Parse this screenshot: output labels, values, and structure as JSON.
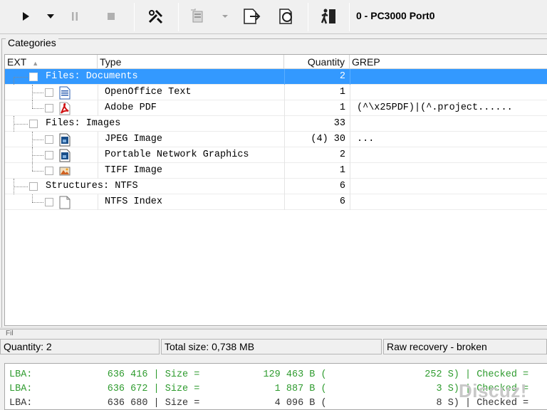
{
  "toolbar": {
    "buttons": [
      {
        "name": "play-button",
        "icon": "play-icon"
      },
      {
        "name": "play-options-dropdown",
        "icon": "chevron-down-icon"
      },
      {
        "name": "pause-button",
        "icon": "pause-icon"
      },
      {
        "name": "stop-button",
        "icon": "stop-icon"
      },
      {
        "name": "tools-button",
        "icon": "tools-icon"
      },
      {
        "name": "add-button",
        "icon": "add-file-icon"
      },
      {
        "name": "export-button",
        "icon": "export-icon"
      },
      {
        "name": "refresh-button",
        "icon": "refresh-icon"
      },
      {
        "name": "exit-button",
        "icon": "exit-icon"
      }
    ],
    "port_title": "0 - PC3000 Port0"
  },
  "categories": {
    "legend": "Categories",
    "columns": {
      "ext": "EXT",
      "type": "Type",
      "quantity": "Quantity",
      "grep": "GREP"
    },
    "rows": [
      {
        "level": 0,
        "type": "Files: Documents",
        "quantity": "2",
        "grep": "",
        "icon": "",
        "selected": true
      },
      {
        "level": 1,
        "type": "OpenOffice Text",
        "quantity": "1",
        "grep": "",
        "icon": "document-icon"
      },
      {
        "level": 1,
        "type": "Adobe PDF",
        "quantity": "1",
        "grep": "(^\\x25PDF)|(^.project......",
        "icon": "pdf-icon"
      },
      {
        "level": 0,
        "type": "Files: Images",
        "quantity": "33",
        "grep": "",
        "icon": ""
      },
      {
        "level": 1,
        "type": "JPEG Image",
        "quantity": "(4) 30",
        "grep": "...",
        "icon": "image-icon"
      },
      {
        "level": 1,
        "type": "Portable Network Graphics",
        "quantity": "2",
        "grep": "",
        "icon": "image-icon"
      },
      {
        "level": 1,
        "type": "TIFF Image",
        "quantity": "1",
        "grep": "",
        "icon": "picture-icon"
      },
      {
        "level": 0,
        "type": "Structures: NTFS",
        "quantity": "6",
        "grep": "",
        "icon": ""
      },
      {
        "level": 1,
        "type": "NTFS Index",
        "quantity": "6",
        "grep": "",
        "icon": "blank-file-icon"
      }
    ]
  },
  "filter_label": "Fil",
  "status": {
    "quantity": "Quantity: 2",
    "total_size": "Total size: 0,738 MB",
    "mode": "Raw recovery - broken"
  },
  "log": {
    "lines": [
      {
        "text": "LBA:             636 416 | Size =           129 463 B (                 252 S) | Checked =",
        "color": "#2e9b2e"
      },
      {
        "text": "LBA:             636 672 | Size =             1 887 B (                   3 S) | Checked =",
        "color": "#2e9b2e"
      },
      {
        "text": "LBA:             636 680 | Size =             4 096 B (                   8 S) | Checked =",
        "color": "#333333"
      }
    ]
  },
  "watermark": "Discuz!"
}
